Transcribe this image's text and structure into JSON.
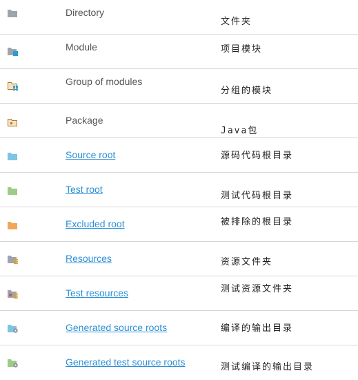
{
  "rows": [
    {
      "name": "Directory",
      "link": false,
      "desc": "文件夹",
      "icon": "folder-gray-icon"
    },
    {
      "name": "Module",
      "link": false,
      "desc": "项目模块",
      "icon": "module-icon"
    },
    {
      "name": "Group of modules",
      "link": false,
      "desc": "分组的模块",
      "icon": "module-group-icon"
    },
    {
      "name": "Package",
      "link": false,
      "desc": "Java包",
      "icon": "package-icon"
    },
    {
      "name": "Source root",
      "link": true,
      "desc": "源码代码根目录",
      "icon": "folder-blue-icon"
    },
    {
      "name": "Test root",
      "link": true,
      "desc": "测试代码根目录",
      "icon": "folder-green-icon"
    },
    {
      "name": "Excluded root",
      "link": true,
      "desc": "被排除的根目录",
      "icon": "folder-orange-icon"
    },
    {
      "name": "Resources",
      "link": true,
      "desc": "资源文件夹",
      "icon": "resources-folder-icon"
    },
    {
      "name": "Test resources",
      "link": true,
      "desc": "测试资源文件夹",
      "icon": "test-resources-folder-icon"
    },
    {
      "name": "Generated source roots",
      "link": true,
      "desc": "编译的输出目录",
      "icon": "generated-source-folder-icon"
    },
    {
      "name": "Generated test source roots",
      "link": true,
      "desc": "测试编译的输出目录",
      "icon": "generated-test-source-folder-icon"
    }
  ],
  "colors": {
    "link": "#2b8fd6",
    "text": "#555555",
    "separator": "#d6d6d6"
  }
}
